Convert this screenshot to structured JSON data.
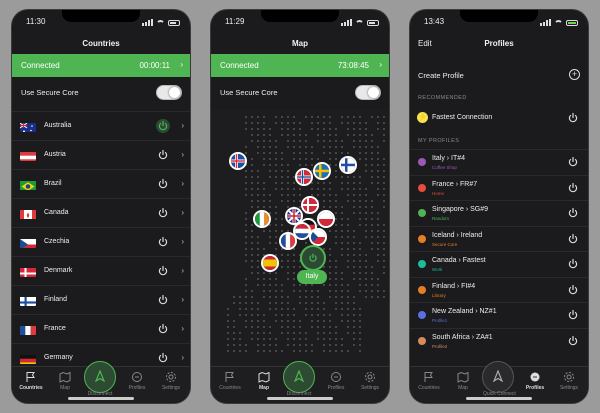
{
  "colors": {
    "accent": "#4fb552",
    "background": "#1b1b1d",
    "outer": "#9b9b9b"
  },
  "countries_screen": {
    "status_time": "11:30",
    "title": "Countries",
    "connection": {
      "label": "Connected",
      "timer": "00:00:11"
    },
    "secure_core_label": "Use Secure Core",
    "countries": [
      {
        "name": "Australia",
        "flag": "australia-flag-icon",
        "active": true
      },
      {
        "name": "Austria",
        "flag": "austria-flag-icon",
        "active": false
      },
      {
        "name": "Brazil",
        "flag": "brazil-flag-icon",
        "active": false
      },
      {
        "name": "Canada",
        "flag": "canada-flag-icon",
        "active": false
      },
      {
        "name": "Czechia",
        "flag": "czechia-flag-icon",
        "active": false
      },
      {
        "name": "Denmark",
        "flag": "denmark-flag-icon",
        "active": false
      },
      {
        "name": "Finland",
        "flag": "finland-flag-icon",
        "active": false
      },
      {
        "name": "France",
        "flag": "france-flag-icon",
        "active": false
      },
      {
        "name": "Germany",
        "flag": "germany-flag-icon",
        "active": false
      }
    ],
    "tabs": [
      "Countries",
      "Map",
      "Disconnect",
      "Profiles",
      "Settings"
    ],
    "active_tab": "Countries"
  },
  "map_screen": {
    "status_time": "11:29",
    "title": "Map",
    "connection": {
      "label": "Connected",
      "timer": "73:08:45"
    },
    "secure_core_label": "Use Secure Core",
    "selected_country_label": "Italy",
    "tabs": [
      "Countries",
      "Map",
      "Disconnect",
      "Profiles",
      "Settings"
    ],
    "active_tab": "Map"
  },
  "profiles_screen": {
    "status_time": "13:43",
    "edit_label": "Edit",
    "title": "Profiles",
    "create_profile_label": "Create Profile",
    "recommended_header": "RECOMMENDED",
    "fastest_label": "Fastest Connection",
    "my_profiles_header": "MY PROFILES",
    "profiles": [
      {
        "name": "Italy  ›  IT#4",
        "sub": "Coffee Shop",
        "color": "#9b59b6"
      },
      {
        "name": "France  ›  FR#7",
        "sub": "Home",
        "color": "#e74c3c"
      },
      {
        "name": "Singapore  ›  SG#9",
        "sub": "Random",
        "color": "#4fb552"
      },
      {
        "name": "Iceland  ›  Ireland",
        "sub": "Secure Core",
        "color": "#e67e22"
      },
      {
        "name": "Canada  ›  Fastest",
        "sub": "Work",
        "color": "#1abc9c"
      },
      {
        "name": "Finland  ›  FI#4",
        "sub": "Library",
        "color": "#e67e22"
      },
      {
        "name": "New Zealand  ›  NZ#1",
        "sub": "Profile1",
        "color": "#5b6ee1"
      },
      {
        "name": "South Africa  ›  ZA#1",
        "sub": "Profile2",
        "color": "#d58c5a"
      }
    ],
    "tabs": [
      "Countries",
      "Map",
      "Quick Connect",
      "Profiles",
      "Settings"
    ],
    "active_tab": "Profiles"
  }
}
